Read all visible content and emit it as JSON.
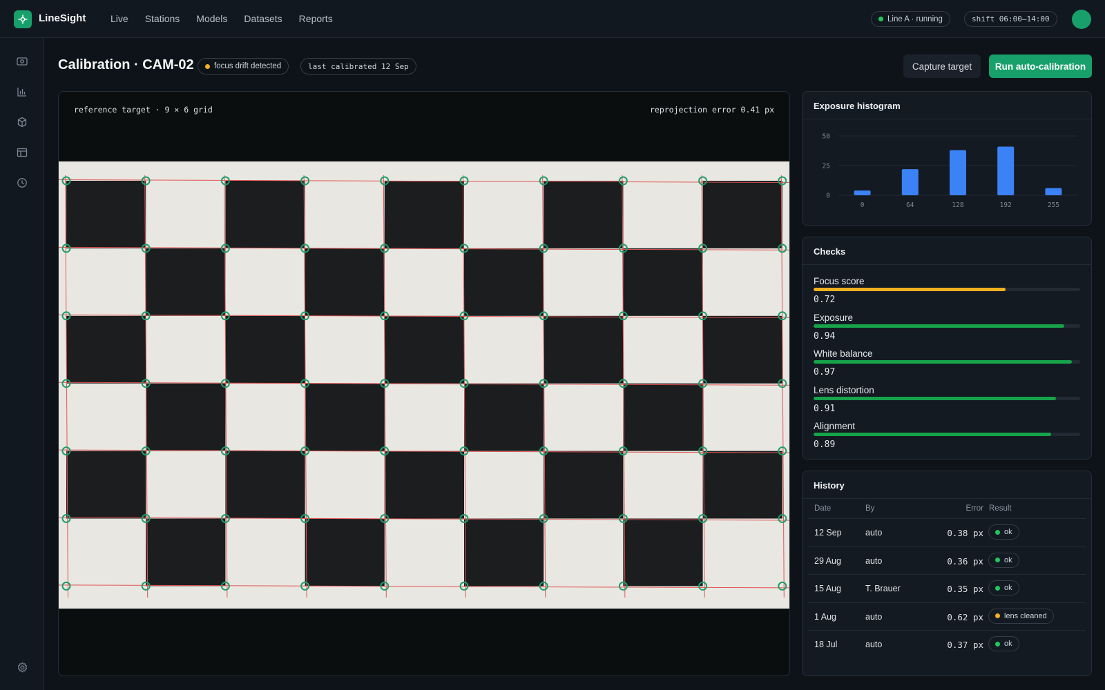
{
  "app": {
    "brand": "LineSight",
    "nav": [
      "Live",
      "Stations",
      "Models",
      "Datasets",
      "Reports"
    ],
    "line_status": "Line A · running",
    "shift": "shift 06:00–14:00"
  },
  "sidebar": {
    "icons": [
      "camera-icon",
      "chart-icon",
      "cube-icon",
      "layout-icon",
      "clock-icon"
    ],
    "footer_icon": "gear-icon"
  },
  "header": {
    "title": "Calibration · CAM-02",
    "alert_tag": "focus drift detected",
    "calibrated_tag": "last calibrated 12 Sep",
    "capture_button": "Capture target",
    "run_button": "Run auto-calibration"
  },
  "viewer": {
    "target_label": "reference target · 9 × 6 grid",
    "error_label": "reprojection error 0.41 px",
    "grid": {
      "cols": 9,
      "rows": 6
    }
  },
  "histogram": {
    "title": "Exposure histogram",
    "chart_data": {
      "type": "bar",
      "x_ticks": [
        "0",
        "64",
        "128",
        "192",
        "255"
      ],
      "y_ticks": [
        "50",
        "25",
        "0"
      ],
      "ylim": [
        0,
        50
      ],
      "values": [
        4,
        22,
        38,
        41,
        6
      ],
      "bar_color": "#3b82f6"
    }
  },
  "checks": {
    "title": "Checks",
    "items": [
      {
        "label": "Focus score",
        "value": "0.72",
        "fraction": 0.72,
        "color": "#f5b020"
      },
      {
        "label": "Exposure",
        "value": "0.94",
        "fraction": 0.94,
        "color": "#16a34a"
      },
      {
        "label": "White balance",
        "value": "0.97",
        "fraction": 0.97,
        "color": "#16a34a"
      },
      {
        "label": "Lens distortion",
        "value": "0.91",
        "fraction": 0.91,
        "color": "#16a34a"
      },
      {
        "label": "Alignment",
        "value": "0.89",
        "fraction": 0.89,
        "color": "#16a34a"
      }
    ]
  },
  "history": {
    "title": "History",
    "columns": [
      "Date",
      "By",
      "Error",
      "Result"
    ],
    "rows": [
      {
        "date": "12 Sep",
        "by": "auto",
        "error": "0.38 px",
        "result": "ok",
        "status": "green"
      },
      {
        "date": "29 Aug",
        "by": "auto",
        "error": "0.36 px",
        "result": "ok",
        "status": "green"
      },
      {
        "date": "15 Aug",
        "by": "T. Brauer",
        "error": "0.35 px",
        "result": "ok",
        "status": "green"
      },
      {
        "date": "1 Aug",
        "by": "auto",
        "error": "0.62 px",
        "result": "lens cleaned",
        "status": "amber"
      },
      {
        "date": "18 Jul",
        "by": "auto",
        "error": "0.37 px",
        "result": "ok",
        "status": "green"
      }
    ]
  }
}
